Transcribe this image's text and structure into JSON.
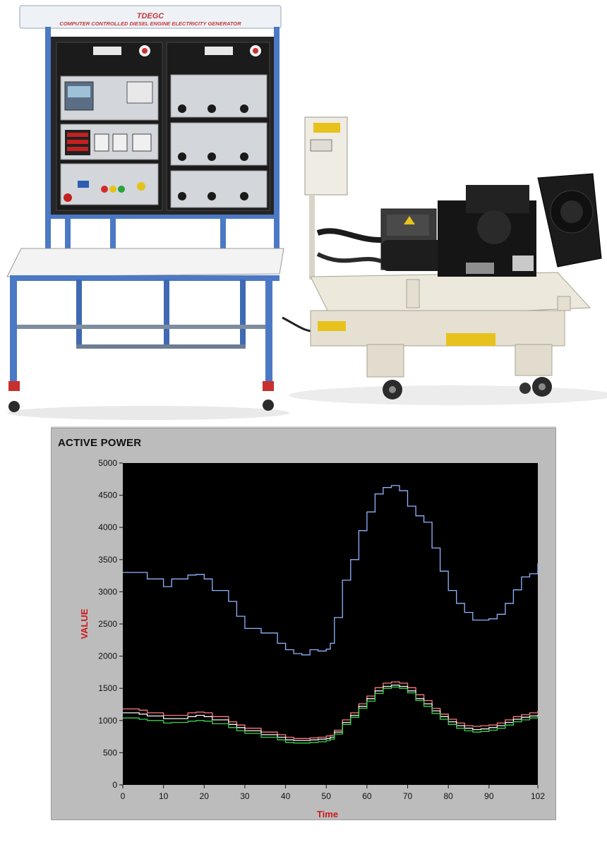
{
  "photo": {
    "panel_sign_code": "TDEGC",
    "panel_sign_subtitle": "COMPUTER CONTROLLED DIESEL ENGINE ELECTRICITY GENERATOR"
  },
  "colors": {
    "plot_bg": "#000000",
    "series_blue": "#8fb4ff",
    "series_red": "#ff7a7a",
    "series_white": "#f4f4f4",
    "series_green": "#3cd24a",
    "axis_title_red": "#d01818",
    "frame_gray": "#bcbcbc"
  },
  "chart_data": {
    "type": "line",
    "title": "ACTIVE POWER",
    "xlabel": "Time",
    "ylabel": "VALUE",
    "xlim": [
      0,
      102
    ],
    "ylim": [
      0,
      5000
    ],
    "x_ticks": [
      0,
      10,
      20,
      30,
      40,
      50,
      60,
      70,
      80,
      90,
      102
    ],
    "y_ticks": [
      0,
      500,
      1000,
      1500,
      2000,
      2500,
      3000,
      3500,
      4000,
      4500,
      5000
    ],
    "grid": false,
    "x": [
      0,
      4,
      6,
      10,
      12,
      16,
      18,
      20,
      22,
      26,
      28,
      30,
      34,
      38,
      40,
      42,
      44,
      46,
      48,
      50,
      51,
      52,
      54,
      56,
      58,
      60,
      62,
      64,
      66,
      68,
      70,
      72,
      74,
      76,
      78,
      80,
      82,
      84,
      86,
      88,
      90,
      92,
      94,
      96,
      98,
      100,
      102
    ],
    "series": [
      {
        "color": "#8fb4ff",
        "values": [
          3300,
          3300,
          3200,
          3080,
          3200,
          3260,
          3270,
          3200,
          3020,
          2850,
          2620,
          2430,
          2360,
          2200,
          2100,
          2040,
          2020,
          2100,
          2080,
          2110,
          2200,
          2600,
          3180,
          3500,
          3950,
          4240,
          4520,
          4620,
          4650,
          4570,
          4330,
          4180,
          4080,
          3680,
          3320,
          3020,
          2820,
          2680,
          2560,
          2560,
          2580,
          2650,
          2820,
          3030,
          3230,
          3280,
          3440
        ]
      },
      {
        "color": "#ff7a7a",
        "values": [
          1180,
          1160,
          1120,
          1080,
          1080,
          1120,
          1130,
          1120,
          1060,
          980,
          930,
          880,
          820,
          780,
          740,
          720,
          720,
          730,
          740,
          760,
          770,
          850,
          1010,
          1120,
          1260,
          1380,
          1510,
          1580,
          1600,
          1580,
          1510,
          1400,
          1310,
          1190,
          1100,
          1020,
          960,
          920,
          910,
          920,
          930,
          960,
          1010,
          1060,
          1090,
          1120,
          1150
        ]
      },
      {
        "color": "#f4f4f4",
        "values": [
          1120,
          1100,
          1070,
          1030,
          1030,
          1060,
          1080,
          1060,
          1010,
          940,
          890,
          840,
          780,
          740,
          700,
          690,
          690,
          700,
          710,
          720,
          740,
          820,
          970,
          1080,
          1220,
          1340,
          1460,
          1530,
          1550,
          1530,
          1460,
          1340,
          1260,
          1150,
          1060,
          980,
          920,
          880,
          860,
          870,
          890,
          920,
          970,
          1020,
          1050,
          1070,
          1090
        ]
      },
      {
        "color": "#3cd24a",
        "values": [
          1040,
          1020,
          1000,
          960,
          970,
          990,
          1000,
          990,
          950,
          890,
          840,
          800,
          740,
          700,
          660,
          650,
          650,
          660,
          670,
          690,
          710,
          790,
          940,
          1050,
          1190,
          1300,
          1420,
          1500,
          1520,
          1500,
          1430,
          1310,
          1220,
          1110,
          1020,
          940,
          880,
          840,
          820,
          830,
          850,
          880,
          930,
          980,
          1010,
          1040,
          1060
        ]
      }
    ]
  }
}
